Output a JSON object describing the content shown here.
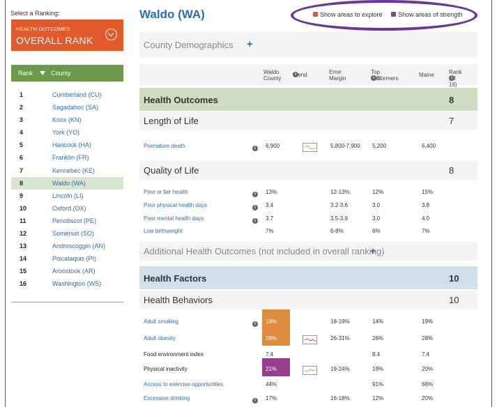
{
  "sidebar": {
    "select_label": "Select a Ranking:",
    "ranking": {
      "category": "HEALTH OUTCOMES",
      "rank": "OVERALL RANK"
    },
    "header": {
      "rank": "Rank",
      "county": "County"
    },
    "counties": [
      {
        "rank": "1",
        "name": "Cumberland (CU)"
      },
      {
        "rank": "2",
        "name": "Sagadahoc (SA)"
      },
      {
        "rank": "3",
        "name": "Knox (KN)"
      },
      {
        "rank": "4",
        "name": "York (YO)"
      },
      {
        "rank": "5",
        "name": "Hancock (HA)"
      },
      {
        "rank": "6",
        "name": "Franklin (FR)"
      },
      {
        "rank": "7",
        "name": "Kennebec (KE)"
      },
      {
        "rank": "8",
        "name": "Waldo (WA)"
      },
      {
        "rank": "9",
        "name": "Lincoln (LI)"
      },
      {
        "rank": "10",
        "name": "Oxford (OX)"
      },
      {
        "rank": "11",
        "name": "Penobscot (PE)"
      },
      {
        "rank": "12",
        "name": "Somerset (SO)"
      },
      {
        "rank": "13",
        "name": "Androscoggin (AN)"
      },
      {
        "rank": "14",
        "name": "Piscataquis (PI)"
      },
      {
        "rank": "15",
        "name": "Aroostook (AR)"
      },
      {
        "rank": "16",
        "name": "Washington (WS)"
      }
    ],
    "active_rank": "8"
  },
  "main": {
    "title": "Waldo (WA)",
    "toggles": {
      "explore": "Show areas to explore",
      "strength": "Show areas of strength"
    },
    "demographics": {
      "label": "County Demographics",
      "plus": "+"
    },
    "columns": {
      "county_l1": "Waldo",
      "county_l2": "County",
      "trend": "Trend",
      "error_l1": "Error",
      "error_l2": "Margin",
      "top_l1": "Top U.S.",
      "top_l2": "Performers",
      "state": "Maine",
      "rank_l1": "Rank",
      "rank_l2": "(of 16)"
    },
    "health_outcomes": {
      "title": "Health Outcomes",
      "rank": "8"
    },
    "length_of_life": {
      "title": "Length of Life",
      "rank": "7"
    },
    "premature_death": {
      "name": "Premature death",
      "value": "6,900",
      "error": "5,800-7,900",
      "top": "5,200",
      "state": "6,400"
    },
    "quality_of_life": {
      "title": "Quality of Life",
      "rank": "8"
    },
    "qol_rows": [
      {
        "name": "Poor or fair health",
        "value": "13%",
        "error": "12-13%",
        "top": "12%",
        "state": "15%"
      },
      {
        "name": "Poor physical health days",
        "value": "3.4",
        "error": "3.2-3.6",
        "top": "3.0",
        "state": "3.8"
      },
      {
        "name": "Poor mental health days",
        "value": "3.7",
        "error": "3.5-3.9",
        "top": "3.0",
        "state": "4.0"
      },
      {
        "name": "Low birthweight",
        "value": "7%",
        "error": "6-8%",
        "top": "6%",
        "state": "7%"
      }
    ],
    "additional": {
      "label": "Additional Health Outcomes (not included in overall ranking)",
      "plus": "+"
    },
    "health_factors": {
      "title": "Health Factors",
      "rank": "10"
    },
    "health_behaviors": {
      "title": "Health Behaviors",
      "rank": "10"
    },
    "hb_rows": [
      {
        "name": "Adult smoking",
        "value": "18%",
        "error": "18-19%",
        "top": "14%",
        "state": "19%"
      },
      {
        "name": "Adult obesity",
        "value": "28%",
        "error": "26-31%",
        "top": "26%",
        "state": "28%"
      },
      {
        "name": "Food environment index",
        "value": "7.4",
        "error": "",
        "top": "8.4",
        "state": "7.4"
      },
      {
        "name": "Physical inactivity",
        "value": "21%",
        "error": "19-24%",
        "top": "19%",
        "state": "20%"
      },
      {
        "name": "Access to exercise opportunities",
        "value": "44%",
        "error": "",
        "top": "91%",
        "state": "68%"
      },
      {
        "name": "Excessive drinking",
        "value": "17%",
        "error": "16-18%",
        "top": "12%",
        "state": "20%"
      }
    ],
    "info_glyph": "i"
  },
  "colors": {
    "accent_orange": "#e05a2b",
    "explore_highlight": "#e08a3c",
    "strength_highlight": "#9b3d8f",
    "green_header": "#6a994a",
    "outcomes_band": "#cfdcc2",
    "factors_band": "#cfe0ea",
    "link_blue": "#2a6ebb",
    "annotation_oval": "#6a35a0"
  }
}
